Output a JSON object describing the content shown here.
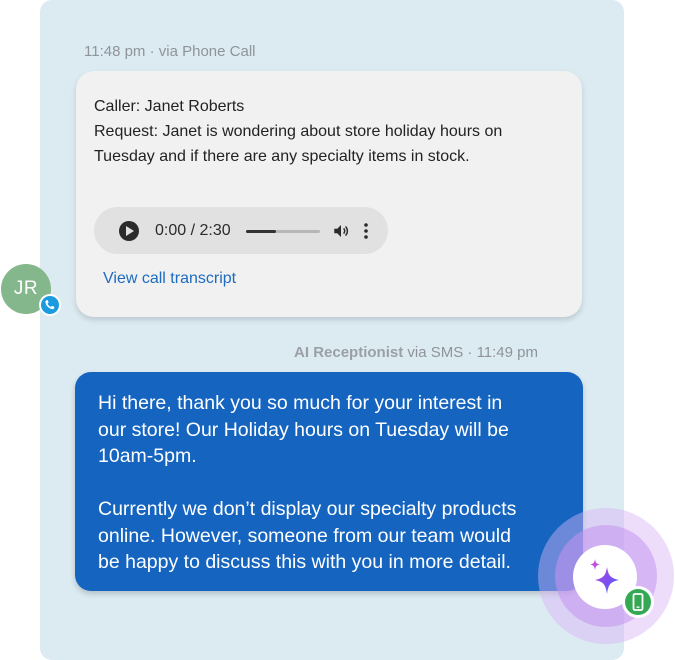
{
  "call_entry": {
    "meta": "11:48 pm · via Phone Call",
    "caller_line": "Caller: Janet Roberts",
    "request_line_1": "Request: Janet is wondering about store holiday hours on",
    "request_line_2": "Tuesday and if there are any specialty items in stock.",
    "audio": {
      "time": "0:00 / 2:30",
      "progress_fraction": 0.4
    },
    "transcript_link": "View call transcript"
  },
  "caller_avatar": {
    "initials": "JR",
    "badge_icon": "phone-icon",
    "avatar_color": "#85b78d",
    "badge_color": "#1a9be0"
  },
  "sms_entry": {
    "sender": "AI Receptionist",
    "meta_suffix": " via SMS · 11:49 pm",
    "message_lines": [
      "Hi there, thank you so much for your interest in",
      "our store! Our Holiday hours on Tuesday will be",
      "10am-5pm.",
      "",
      "Currently we don’t display our specialty products",
      "online. However, someone from our team would",
      "be happy to discuss this with you in more detail."
    ],
    "bubble_color": "#1565c0"
  },
  "ai_avatar": {
    "icon": "sparkle-icon",
    "badge_icon": "mobile-phone-icon",
    "badge_color": "#34a853"
  },
  "colors": {
    "panel_background": "#dceaf2",
    "link": "#1e6bbf"
  }
}
